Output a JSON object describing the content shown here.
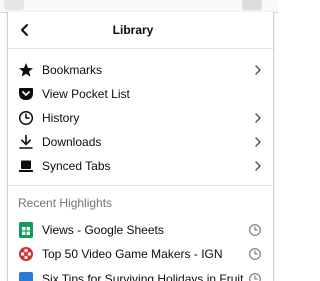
{
  "header": {
    "title": "Library",
    "back_icon": "chevron-left-icon"
  },
  "menu": {
    "items": [
      {
        "label": "Bookmarks",
        "icon": "star-icon",
        "has_submenu": true
      },
      {
        "label": "View Pocket List",
        "icon": "pocket-icon",
        "has_submenu": false
      },
      {
        "label": "History",
        "icon": "clock-icon",
        "has_submenu": true
      },
      {
        "label": "Downloads",
        "icon": "download-icon",
        "has_submenu": true
      },
      {
        "label": "Synced Tabs",
        "icon": "synced-tabs-icon",
        "has_submenu": true
      }
    ]
  },
  "recent": {
    "title": "Recent Highlights",
    "items": [
      {
        "label": "Views - Google Sheets",
        "icon": "google-sheets-icon",
        "action_icon": "clock-icon"
      },
      {
        "label": "Top 50 Video Game Makers - IGN",
        "icon": "ign-icon",
        "action_icon": "clock-icon"
      },
      {
        "label": "Six Tips for Surviving Holidays in Fruit Ni",
        "icon": "site-favicon",
        "action_icon": "clock-icon"
      }
    ]
  },
  "colors": {
    "text": "#0c0c0d",
    "muted": "#737373",
    "sheets_green": "#0f9d58",
    "ign_red": "#d32f2f"
  }
}
